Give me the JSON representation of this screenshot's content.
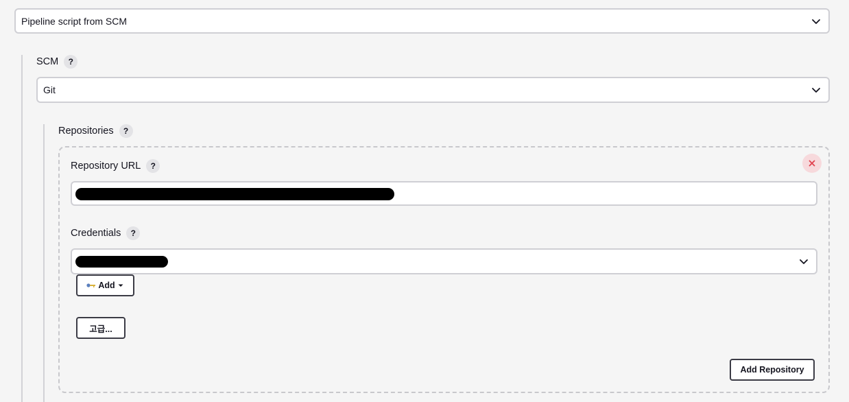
{
  "definition_select": {
    "value": "Pipeline script from SCM"
  },
  "scm": {
    "label": "SCM",
    "help": "?",
    "value": "Git"
  },
  "repositories": {
    "label": "Repositories",
    "help": "?",
    "url_label": "Repository URL",
    "url_help": "?",
    "credentials_label": "Credentials",
    "credentials_help": "?",
    "add_label": "Add",
    "advanced_label": "고급...",
    "add_repository_label": "Add Repository"
  },
  "colors": {
    "background": "#f5f5f5",
    "danger": "#e0434f",
    "danger_bg": "#f7d9dc"
  }
}
